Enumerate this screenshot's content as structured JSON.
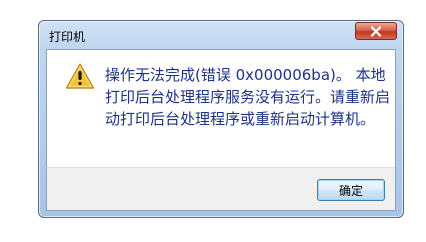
{
  "window": {
    "title": "打印机",
    "close_icon": "close-icon"
  },
  "dialog": {
    "icon": "warning-icon",
    "message": "操作无法完成(错误 0x000006ba)。 本地打印后台处理程序服务没有运行。请重新启动打印后台处理程序或重新启动计算机。"
  },
  "buttons": {
    "ok_label": "确定"
  },
  "colors": {
    "message_text": "#1e3287",
    "warning_fill": "#f5c431",
    "close_button": "#c2391f",
    "ok_border": "#3c7fb1"
  }
}
